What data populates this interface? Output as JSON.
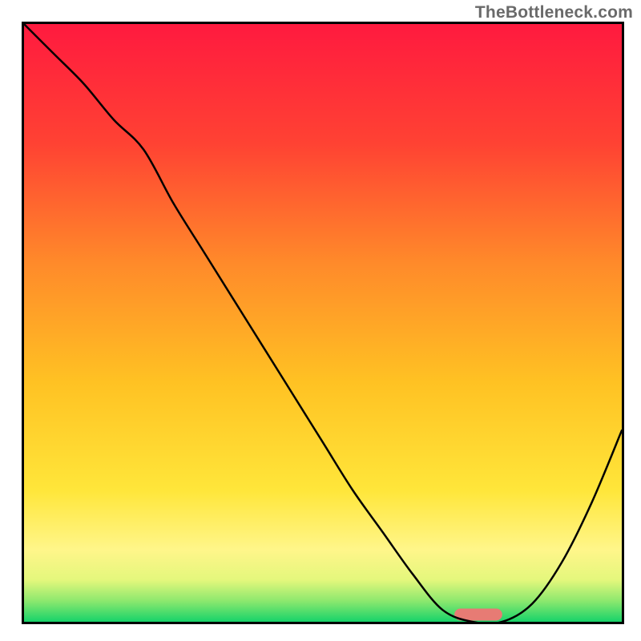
{
  "watermark": "TheBottleneck.com",
  "chart_data": {
    "type": "line",
    "title": "",
    "xlabel": "",
    "ylabel": "",
    "xlim": [
      0,
      100
    ],
    "ylim": [
      0,
      100
    ],
    "x": [
      0,
      5,
      10,
      15,
      20,
      25,
      30,
      35,
      40,
      45,
      50,
      55,
      60,
      65,
      70,
      75,
      80,
      85,
      90,
      95,
      100
    ],
    "values": [
      100,
      95,
      90,
      84,
      79,
      70,
      62,
      54,
      46,
      38,
      30,
      22,
      15,
      8,
      2,
      0,
      0,
      3,
      10,
      20,
      32
    ],
    "gradient_stops": [
      {
        "offset": 0.0,
        "color": "#ff1a3f"
      },
      {
        "offset": 0.2,
        "color": "#ff4233"
      },
      {
        "offset": 0.4,
        "color": "#ff8a2a"
      },
      {
        "offset": 0.6,
        "color": "#ffc223"
      },
      {
        "offset": 0.78,
        "color": "#ffe63a"
      },
      {
        "offset": 0.88,
        "color": "#fff68a"
      },
      {
        "offset": 0.93,
        "color": "#e4f77c"
      },
      {
        "offset": 0.965,
        "color": "#8de86e"
      },
      {
        "offset": 1.0,
        "color": "#17d36a"
      }
    ],
    "marker": {
      "rect_x": [
        72,
        80
      ],
      "rect_y": 0.2,
      "fill": "#e77b74"
    }
  }
}
